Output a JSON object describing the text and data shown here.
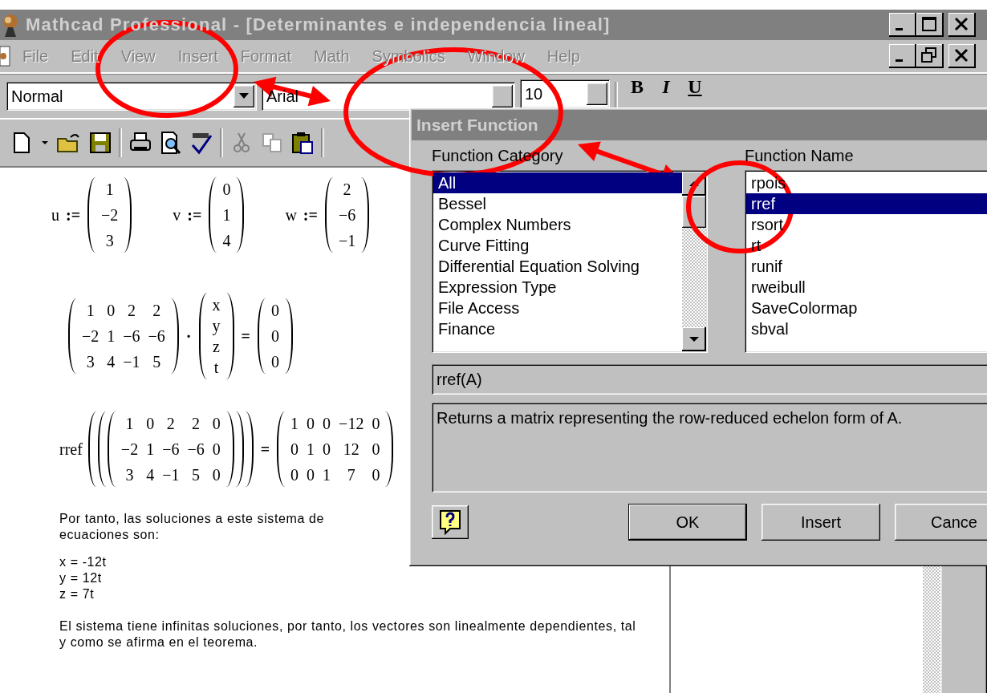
{
  "window": {
    "title": "Mathcad Professional - [Determinantes e independencia lineal]"
  },
  "menu": [
    {
      "label": "File",
      "disabled": true
    },
    {
      "label": "Edit",
      "disabled": true
    },
    {
      "label": "View",
      "disabled": true
    },
    {
      "label": "Insert",
      "disabled": true
    },
    {
      "label": "Format",
      "disabled": true
    },
    {
      "label": "Math",
      "disabled": true
    },
    {
      "label": "Symbolics",
      "disabled": true
    },
    {
      "label": "Window",
      "disabled": true
    },
    {
      "label": "Help",
      "disabled": true
    }
  ],
  "format_bar": {
    "style": "Normal",
    "font": "Arial",
    "size": "10",
    "styles": [
      "B",
      "I",
      "U"
    ]
  },
  "document": {
    "equations": [
      [
        {
          "kind": "symbol",
          "text": "u"
        },
        {
          "kind": "operator",
          "text": ":="
        },
        {
          "kind": "matrix",
          "rows": [
            [
              "1"
            ],
            [
              "−2"
            ],
            [
              "3"
            ]
          ]
        },
        {
          "kind": "space"
        },
        {
          "kind": "symbol",
          "text": "v"
        },
        {
          "kind": "operator",
          "text": ":="
        },
        {
          "kind": "matrix",
          "rows": [
            [
              "0"
            ],
            [
              "1"
            ],
            [
              "4"
            ]
          ]
        },
        {
          "kind": "space"
        },
        {
          "kind": "symbol",
          "text": "w"
        },
        {
          "kind": "operator",
          "text": ":="
        },
        {
          "kind": "matrix",
          "rows": [
            [
              "2"
            ],
            [
              "−6"
            ],
            [
              "−1"
            ]
          ]
        }
      ],
      [
        {
          "kind": "matrix",
          "rows": [
            [
              "1",
              "0",
              "2",
              "2"
            ],
            [
              "−2",
              "1",
              "−6",
              "−6"
            ],
            [
              "3",
              "4",
              "−1",
              "5"
            ]
          ]
        },
        {
          "kind": "operator",
          "text": "·"
        },
        {
          "kind": "matrix",
          "rows": [
            [
              "x"
            ],
            [
              "y"
            ],
            [
              "z"
            ],
            [
              "t"
            ]
          ]
        },
        {
          "kind": "operator",
          "text": "="
        },
        {
          "kind": "matrix",
          "rows": [
            [
              "0"
            ],
            [
              "0"
            ],
            [
              "0"
            ]
          ]
        }
      ],
      [
        {
          "kind": "call",
          "name": "rref",
          "rows": [
            [
              "1",
              "0",
              "2",
              "2",
              "0"
            ],
            [
              "−2",
              "1",
              "−6",
              "−6",
              "0"
            ],
            [
              "3",
              "4",
              "−1",
              "5",
              "0"
            ]
          ]
        },
        {
          "kind": "operator",
          "text": "="
        },
        {
          "kind": "matrix",
          "rows": [
            [
              "1",
              "0",
              "0",
              "−12",
              "0"
            ],
            [
              "0",
              "1",
              "0",
              "12",
              "0"
            ],
            [
              "0",
              "0",
              "1",
              "7",
              "0"
            ]
          ]
        }
      ]
    ],
    "text_blocks": [
      {
        "kind": "paragraph",
        "text": "Por tanto, las soluciones a este sistema de ecuaciones son:"
      },
      {
        "kind": "lines",
        "lines": [
          "x = -12t",
          "y = 12t",
          "z = 7t"
        ]
      },
      {
        "kind": "paragraph",
        "text": "El sistema tiene infinitas soluciones, por tanto, los vectores son linealmente dependientes, tal y como se afirma en el teorema."
      }
    ]
  },
  "dialog": {
    "title": "Insert Function",
    "category_label": "Function Category",
    "name_label": "Function Name",
    "categories": [
      {
        "label": "All",
        "selected": true
      },
      {
        "label": "Bessel",
        "selected": false
      },
      {
        "label": "Complex Numbers",
        "selected": false
      },
      {
        "label": "Curve Fitting",
        "selected": false
      },
      {
        "label": "Differential Equation Solving",
        "selected": false
      },
      {
        "label": "Expression Type",
        "selected": false
      },
      {
        "label": "File Access",
        "selected": false
      },
      {
        "label": "Finance",
        "selected": false
      }
    ],
    "names": [
      {
        "label": "rpois",
        "selected": false
      },
      {
        "label": "rref",
        "selected": true
      },
      {
        "label": "rsort",
        "selected": false
      },
      {
        "label": "rt",
        "selected": false
      },
      {
        "label": "runif",
        "selected": false
      },
      {
        "label": "rweibull",
        "selected": false
      },
      {
        "label": "SaveColormap",
        "selected": false
      },
      {
        "label": "sbval",
        "selected": false
      }
    ],
    "signature": "rref(A)",
    "description": "Returns a matrix representing the row-reduced echelon form of A.",
    "buttons": [
      {
        "label": "OK",
        "kind": "default"
      },
      {
        "label": "Insert",
        "kind": "normal"
      },
      {
        "label": "Cance",
        "kind": "normal"
      }
    ]
  }
}
